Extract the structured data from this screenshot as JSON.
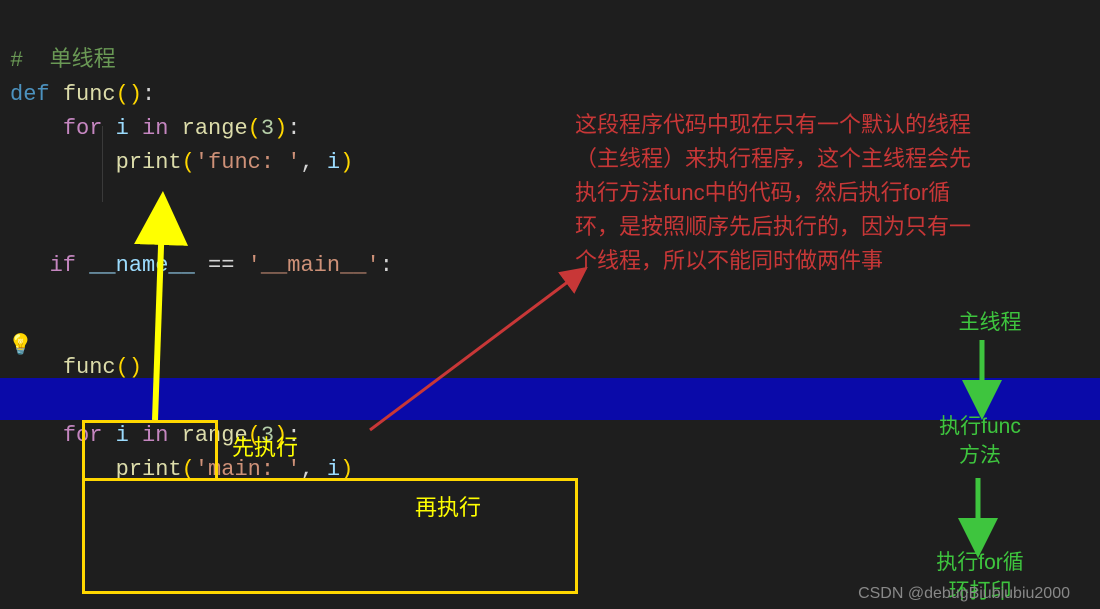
{
  "code": {
    "line1": {
      "comment": "#  单线程"
    },
    "line2": {
      "def": "def",
      "name": "func",
      "sig": "():"
    },
    "line3": {
      "for": "for",
      "i": "i",
      "in": "in",
      "range": "range",
      "num": "3",
      "after": "):"
    },
    "line4": {
      "print": "print",
      "open": "(",
      "str": "'func: '",
      "comma": ", ",
      "arg": "i",
      "close": ")"
    },
    "line5": {
      "if": "if",
      "dunder1": "__name__",
      "eq": "==",
      "str": "'__main__'",
      "colon": ":"
    },
    "line6": {
      "call": "func",
      "parens": "()"
    },
    "line7": {
      "for": "for",
      "i": "i",
      "in": "in",
      "range": "range",
      "num": "3",
      "after": "):"
    },
    "line8": {
      "print": "print",
      "open": "(",
      "str": "'main: '",
      "comma": ", ",
      "arg": "i",
      "close": ")"
    }
  },
  "annotations": {
    "red_paragraph_l1": "这段程序代码中现在只有一个默认的线程",
    "red_paragraph_l2": "（主线程）来执行程序，这个主线程会先",
    "red_paragraph_l3": "执行方法func中的代码，然后执行for循",
    "red_paragraph_l4": "环，是按照顺序先后执行的，因为只有一",
    "red_paragraph_l5": "个线程，所以不能同时做两件事",
    "yellow_first": "先执行",
    "yellow_second": "再执行",
    "green_main_thread": "主线程",
    "green_exec_func_l1": "执行func",
    "green_exec_func_l2": "方法",
    "green_exec_for_l1": "执行for循",
    "green_exec_for_l2": "环打印"
  },
  "icons": {
    "bulb": "💡"
  },
  "watermark": "CSDN @debugBiubiubiu2000"
}
